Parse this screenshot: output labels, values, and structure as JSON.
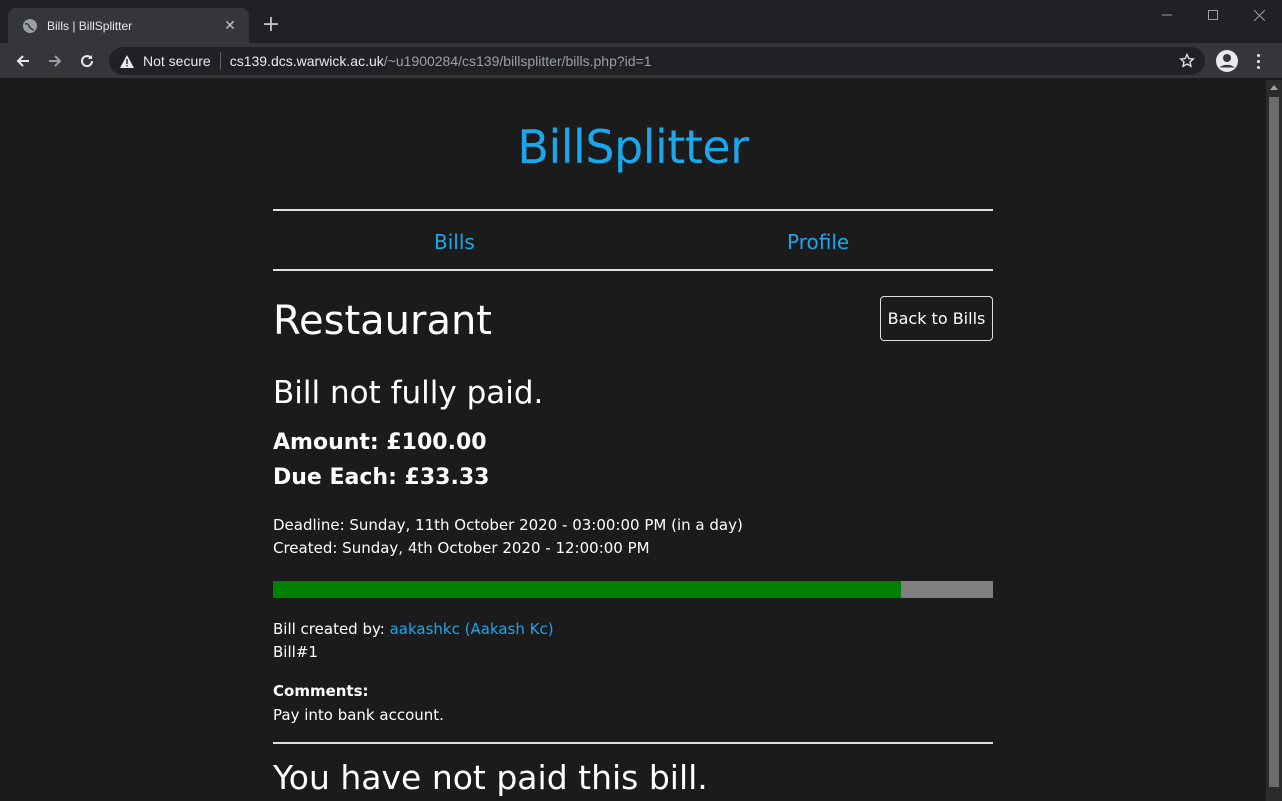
{
  "browser": {
    "tab_title": "Bills | BillSplitter",
    "security_label": "Not secure",
    "url_host": "cs139.dcs.warwick.ac.uk",
    "url_path": "/~u1900284/cs139/billsplitter/bills.php?id=1"
  },
  "site": {
    "brand": "BillSplitter",
    "nav": {
      "bills": "Bills",
      "profile": "Profile"
    }
  },
  "bill": {
    "title": "Restaurant",
    "back_button": "Back to Bills",
    "status": "Bill not fully paid.",
    "amount_label": "Amount: £100.00",
    "due_each_label": "Due Each: £33.33",
    "deadline": "Deadline: Sunday, 11th October 2020 - 03:00:00 PM (in a day)",
    "created": "Created: Sunday, 4th October 2020 - 12:00:00 PM",
    "progress_paid_fraction": 0.872,
    "progress_color_paid": "#008000",
    "progress_color_remaining": "#808080",
    "created_by_label": "Bill created by: ",
    "created_by_user": "aakashkc (Aakash Kc)",
    "bill_number": "Bill#1",
    "comments_label": "Comments:",
    "comments": "Pay into bank account.",
    "payment_status": "You have not paid this bill."
  },
  "colors": {
    "accent": "#1aa7ec",
    "background": "#1b1b1b"
  }
}
